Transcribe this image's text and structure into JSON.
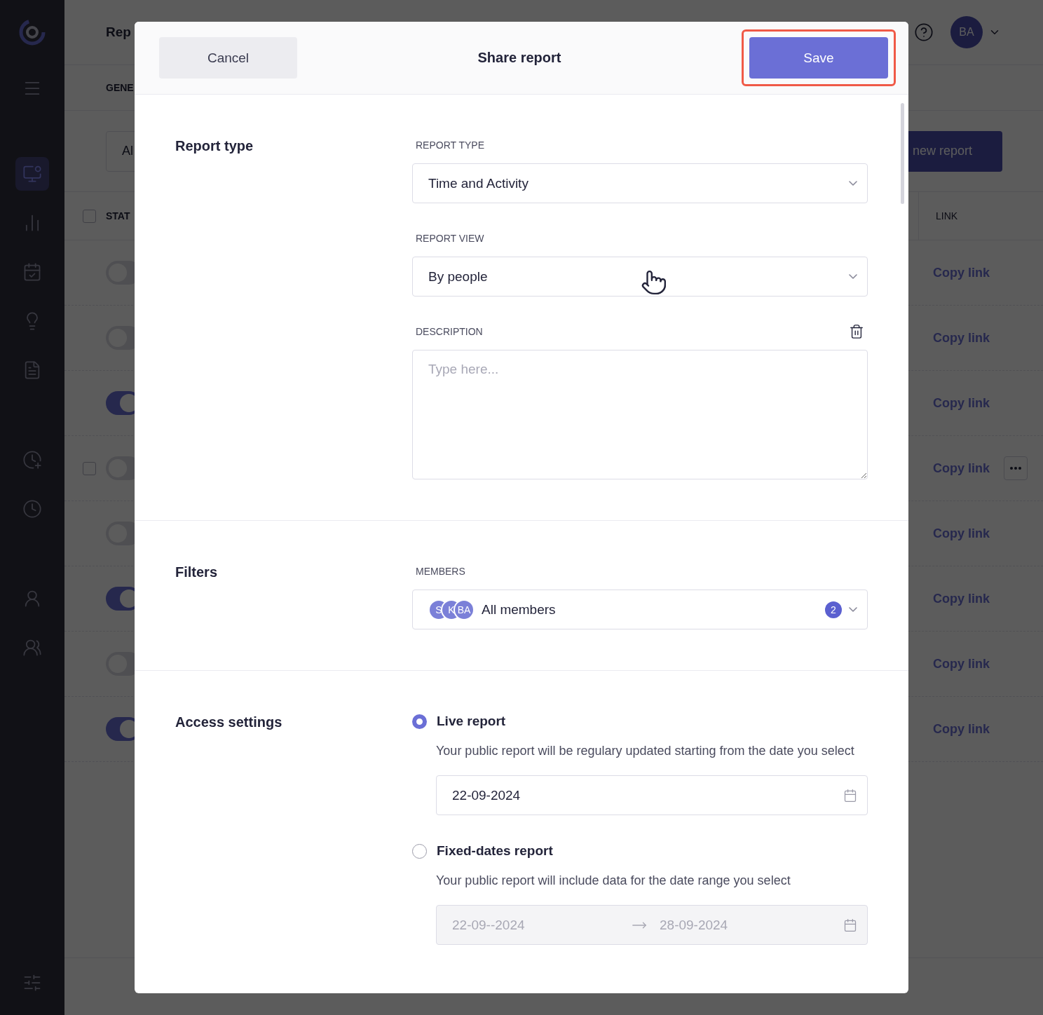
{
  "sidebar": {
    "items": [
      {
        "kind": "menu",
        "selected": false
      },
      {
        "kind": "monitor",
        "selected": true
      },
      {
        "kind": "chart",
        "selected": false
      },
      {
        "kind": "calendar",
        "selected": false
      },
      {
        "kind": "bulb",
        "selected": false
      },
      {
        "kind": "file",
        "selected": false
      },
      {
        "kind": "clock-plus",
        "selected": false
      },
      {
        "kind": "clock-off",
        "selected": false
      },
      {
        "kind": "user",
        "selected": false
      },
      {
        "kind": "users",
        "selected": false
      },
      {
        "kind": "sliders",
        "selected": false
      }
    ]
  },
  "page": {
    "title": "Rep",
    "tab": "GENE",
    "search_value": "Al",
    "new_report_button": "new report",
    "avatar": "BA",
    "select_all": {
      "checked": false
    },
    "columns": [
      "STAT",
      "LINK"
    ],
    "rows": [
      {
        "enabled": false,
        "link": "Copy link",
        "hovered": false
      },
      {
        "enabled": false,
        "link": "Copy link",
        "hovered": false
      },
      {
        "enabled": true,
        "link": "Copy link",
        "hovered": false
      },
      {
        "enabled": false,
        "link": "Copy link",
        "hovered": true,
        "checked": false
      },
      {
        "enabled": false,
        "link": "Copy link",
        "hovered": false
      },
      {
        "enabled": true,
        "link": "Copy link",
        "hovered": false
      },
      {
        "enabled": false,
        "link": "Copy link",
        "hovered": false
      },
      {
        "enabled": true,
        "link": "Copy link",
        "hovered": false
      }
    ]
  },
  "modal": {
    "title": "Share report",
    "cancel": "Cancel",
    "save": {
      "label": "Save",
      "highlighted": true
    },
    "report_type": {
      "heading": "Report type",
      "type_label": "REPORT TYPE",
      "type_value": "Time and Activity",
      "view_label": "REPORT VIEW",
      "view_value": "By people",
      "description_label": "DESCRIPTION",
      "description_placeholder": "Type here..."
    },
    "filters": {
      "heading": "Filters",
      "members_label": "MEMBERS",
      "avatars": [
        "S",
        "K",
        "BA"
      ],
      "members_value": "All members",
      "count": "2"
    },
    "access": {
      "heading": "Access settings",
      "options": [
        {
          "kind": "single",
          "label": "Live report",
          "selected": true,
          "description": "Your public report will be regulary updated starting from the date you select",
          "date": "22-09-2024"
        },
        {
          "kind": "range",
          "label": "Fixed-dates report",
          "selected": false,
          "description": "Your public report will include data for the date range you select",
          "start": "22-09--2024",
          "end": "28-09-2024"
        }
      ]
    }
  }
}
